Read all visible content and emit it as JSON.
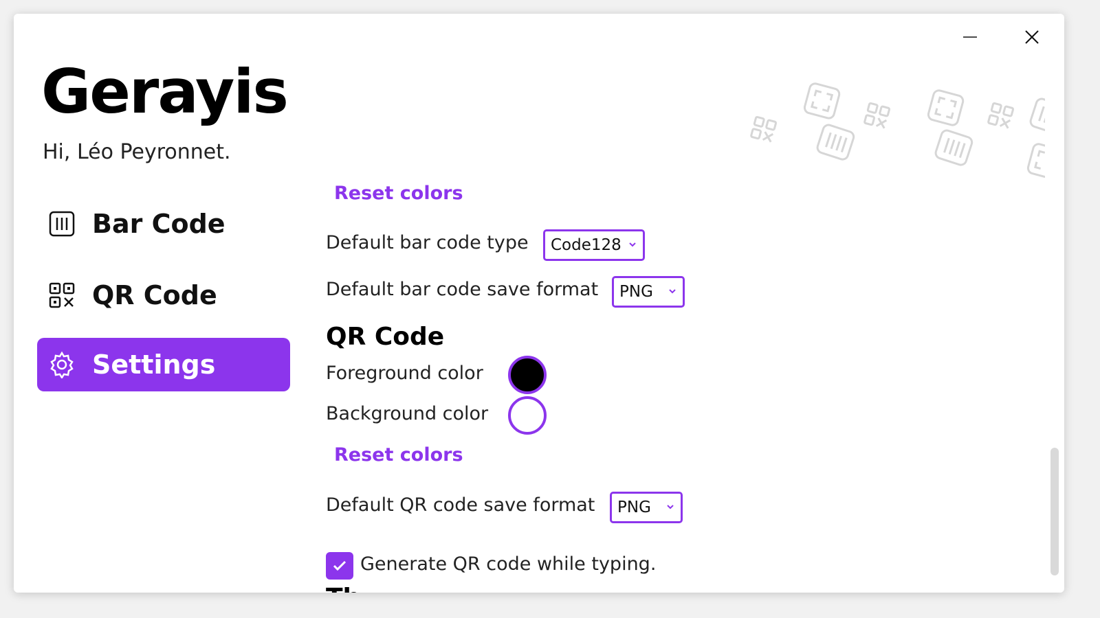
{
  "app": {
    "title": "Gerayis",
    "greeting": "Hi, Léo Peyronnet."
  },
  "window_controls": {
    "minimize": "minimize",
    "close": "close"
  },
  "sidebar": {
    "items": [
      {
        "label": "Bar Code",
        "icon": "barcode-icon",
        "active": false
      },
      {
        "label": "QR Code",
        "icon": "qrcode-icon",
        "active": false
      },
      {
        "label": "Settings",
        "icon": "gear-icon",
        "active": true
      }
    ]
  },
  "settings": {
    "barcode": {
      "reset_colors": "Reset colors",
      "default_type_label": "Default bar code type",
      "default_type_value": "Code128",
      "save_format_label": "Default bar code save format",
      "save_format_value": "PNG"
    },
    "qrcode": {
      "section_title": "QR Code",
      "foreground_label": "Foreground color",
      "foreground_color": "#000000",
      "background_label": "Background color",
      "background_color": "#ffffff",
      "reset_colors": "Reset colors",
      "save_format_label": "Default QR code save format",
      "save_format_value": "PNG",
      "generate_while_typing_label": "Generate QR code while typing.",
      "generate_while_typing_checked": true
    },
    "next_section_partial": "Th"
  },
  "colors": {
    "accent": "#8c35ec"
  }
}
